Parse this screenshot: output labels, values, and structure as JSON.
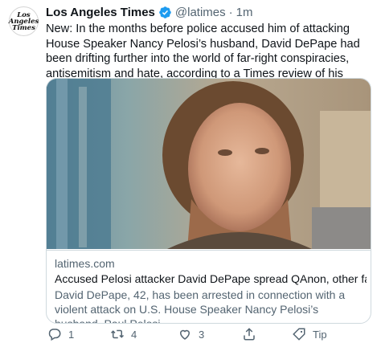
{
  "avatar": {
    "line1": "Los",
    "line2": "Angeles",
    "line3": "Times"
  },
  "tweet": {
    "author": "Los Angeles Times",
    "handle": "@latimes",
    "separator": "·",
    "time": "1m",
    "text": "New: In the months before police accused him of attacking House Speaker Nancy Pelosi’s husband, David DePape had been drifting further into the world of far-right conspiracies, antisemitism and hate, according to a Times review of his online accounts."
  },
  "card": {
    "domain": "latimes.com",
    "title": "Accused Pelosi attacker David DePape spread QAnon, other far-right,...",
    "description": "David DePape, 42, has been arrested in connection with a violent attack on U.S. House Speaker Nancy Pelosi’s husband, Paul Pelosi."
  },
  "actions": {
    "reply_count": "1",
    "retweet_count": "4",
    "like_count": "3",
    "tip_label": "Tip"
  },
  "colors": {
    "verified": "#1d9bf0",
    "secondary_text": "#536471",
    "card_border": "#cfd9de"
  },
  "icons": [
    "verified-badge-icon",
    "reply-icon",
    "retweet-icon",
    "like-icon",
    "share-icon",
    "tip-icon"
  ]
}
